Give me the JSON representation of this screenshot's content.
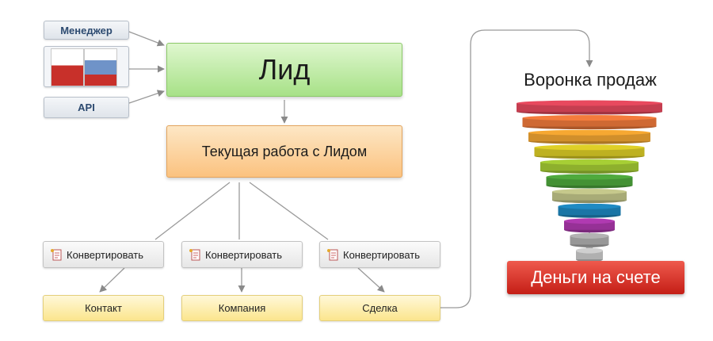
{
  "sources": {
    "manager_label": "Менеджер",
    "api_label": "API",
    "products_image": "1c-bitrix-product-boxes"
  },
  "lead": {
    "label": "Лид"
  },
  "work": {
    "label": "Текущая работа с Лидом"
  },
  "convert": [
    {
      "label": "Конвертировать"
    },
    {
      "label": "Конвертировать"
    },
    {
      "label": "Конвертировать"
    }
  ],
  "targets": [
    {
      "label": "Контакт"
    },
    {
      "label": "Компания"
    },
    {
      "label": "Сделка"
    }
  ],
  "funnel": {
    "title": "Воронка продаж",
    "stage_colors": [
      "#e8495e",
      "#f47c3c",
      "#f6a832",
      "#dfd027",
      "#a7cf35",
      "#4faa3d",
      "#c6c98c",
      "#1f8ac3",
      "#b03ab1",
      "#b3b3b3",
      "#cfcfcf"
    ]
  },
  "money": {
    "label": "Деньги на счете"
  },
  "colors": {
    "connector": "#9a9a9a",
    "lead_green": "#a7e187",
    "work_orange": "#fbc27f",
    "money_red": "#c41e16"
  }
}
